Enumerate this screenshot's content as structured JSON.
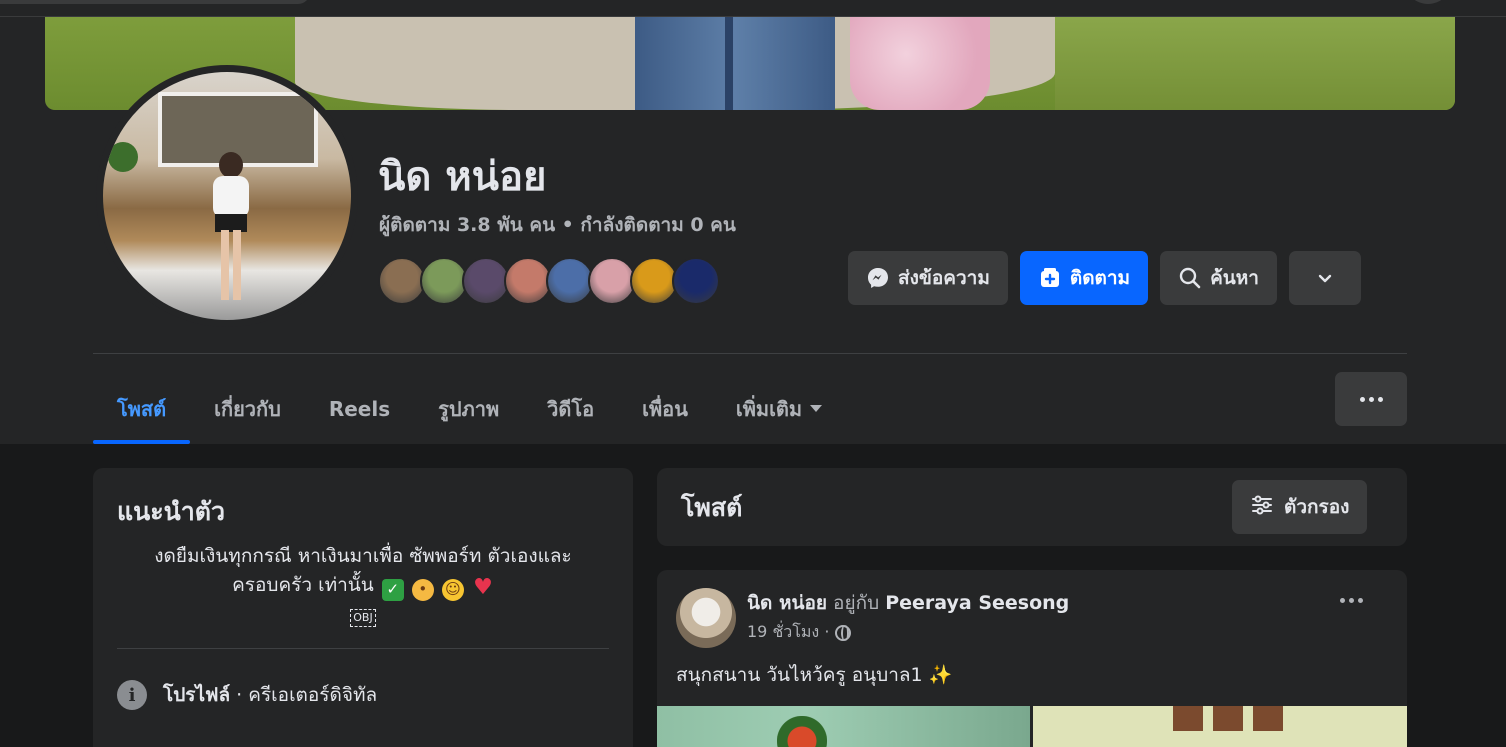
{
  "profile": {
    "name": "นิด หน่อย",
    "stats": "ผู้ติดตาม 3.8 พัน คน • กำลังติดตาม 0 คน"
  },
  "friend_avatar_colors": [
    "#8a6e52",
    "#7c9a5a",
    "#5a4a6a",
    "#c47a6a",
    "#4c6ea8",
    "#d8a0a8",
    "#d99a1a",
    "#1a2a6a"
  ],
  "actions": {
    "message_label": "ส่งข้อความ",
    "follow_label": "ติดตาม",
    "search_label": "ค้นหา"
  },
  "tabs": [
    {
      "label": "โพสต์",
      "active": true
    },
    {
      "label": "เกี่ยวกับ"
    },
    {
      "label": "Reels"
    },
    {
      "label": "รูปภาพ"
    },
    {
      "label": "วิดีโอ"
    },
    {
      "label": "เพื่อน"
    },
    {
      "label": "เพิ่มเติม"
    }
  ],
  "intro": {
    "title": "แนะนำตัว",
    "bio_line1": "งดยืมเงินทุกกรณี หาเงินมาเพื่อ ซัพพอร์ท ตัวเองและ",
    "bio_line2": "ครอบครัว เท่านั้น",
    "obj": "OBJ",
    "profile_label": "โปรไฟล์",
    "profile_category": " · ครีเอเตอร์ดิจิทัล"
  },
  "posts": {
    "title": "โพสต์",
    "filter_label": "ตัวกรอง"
  },
  "post": {
    "author": "นิด หน่อย",
    "with_text": " อยู่กับ ",
    "tagged": "Peeraya Seesong",
    "time": "19 ชั่วโมง ·",
    "text": "สนุกสนาน วันไหว้ครู อนุบาล1 ✨"
  },
  "colors": {
    "accent": "#0866ff",
    "active_tab": "#4599ff",
    "background": "#18191a",
    "surface": "#242526"
  }
}
